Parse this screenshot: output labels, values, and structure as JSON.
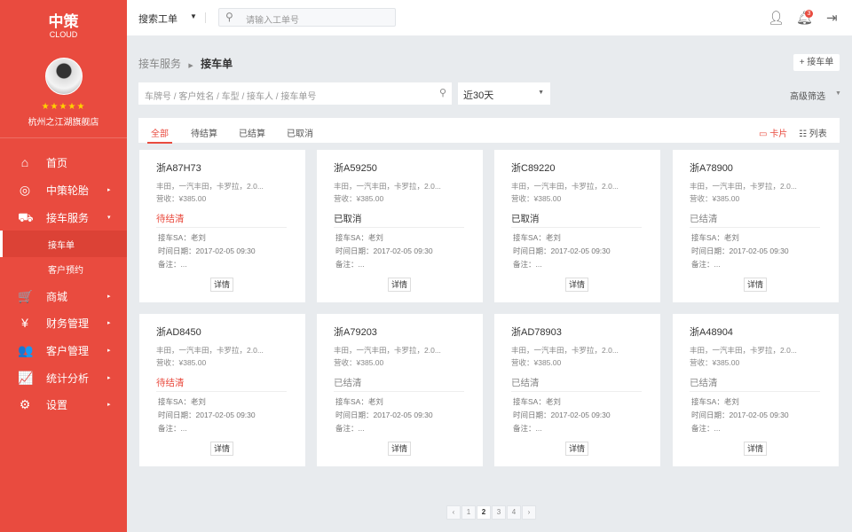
{
  "sidebar": {
    "logo_cn": "中策",
    "logo_en": "CLOUD",
    "stars": "★★★★★",
    "store": "杭州之江湖旗舰店",
    "items": [
      {
        "label": "首页",
        "icon": "⌂",
        "arrow": ""
      },
      {
        "label": "中策轮胎",
        "icon": "◎",
        "arrow": "▸"
      },
      {
        "label": "接车服务",
        "icon": "⛟",
        "arrow": "▾"
      },
      {
        "label": "接车单",
        "icon": "",
        "arrow": ""
      },
      {
        "label": "客户预约",
        "icon": "",
        "arrow": ""
      },
      {
        "label": "商城",
        "icon": "🛒",
        "arrow": "▸"
      },
      {
        "label": "财务管理",
        "icon": "¥",
        "arrow": "▸"
      },
      {
        "label": "客户管理",
        "icon": "👥",
        "arrow": "▸"
      },
      {
        "label": "统计分析",
        "icon": "📈",
        "arrow": "▸"
      },
      {
        "label": "设置",
        "icon": "⚙",
        "arrow": "▸"
      }
    ]
  },
  "topbar": {
    "search_type": "搜索工单",
    "search_placeholder": "请输入工单号",
    "notif_count": "3"
  },
  "breadcrumb": {
    "parent": "接车服务",
    "current": "接车单"
  },
  "add_button": "+ 接车单",
  "filter": {
    "placeholder": "车牌号 / 客户姓名 / 车型 / 接车人 / 接车单号",
    "range": "近30天",
    "advanced": "高级筛选"
  },
  "tabs": [
    "全部",
    "待结算",
    "已结算",
    "已取消"
  ],
  "views": {
    "card": "卡片",
    "list": "列表"
  },
  "colors": {
    "accent": "#e94b3f",
    "unpaid": "#e94b3f",
    "cancelled": "#333333",
    "paid": "#888888"
  },
  "cards": [
    {
      "plate": "浙A87H73",
      "model": "丰田，一汽丰田，卡罗拉，2.0...",
      "revenue": "营收：¥385.00",
      "status": "待结清",
      "status_type": "unpaid",
      "sa": "接车SA：老刘",
      "time": "时间日期：2017-02-05 09:30",
      "note": "备注：...",
      "btn": "详情"
    },
    {
      "plate": "浙A59250",
      "model": "丰田，一汽丰田，卡罗拉，2.0...",
      "revenue": "营收：¥385.00",
      "status": "已取消",
      "status_type": "cancelled",
      "sa": "接车SA：老刘",
      "time": "时间日期：2017-02-05 09:30",
      "note": "备注：...",
      "btn": "详情"
    },
    {
      "plate": "浙C89220",
      "model": "丰田，一汽丰田，卡罗拉，2.0...",
      "revenue": "营收：¥385.00",
      "status": "已取消",
      "status_type": "cancelled",
      "sa": "接车SA：老刘",
      "time": "时间日期：2017-02-05 09:30",
      "note": "备注：...",
      "btn": "详情"
    },
    {
      "plate": "浙A78900",
      "model": "丰田，一汽丰田，卡罗拉，2.0...",
      "revenue": "营收：¥385.00",
      "status": "已结清",
      "status_type": "paid",
      "sa": "接车SA：老刘",
      "time": "时间日期：2017-02-05 09:30",
      "note": "备注：...",
      "btn": "详情"
    },
    {
      "plate": "浙AD8450",
      "model": "丰田，一汽丰田，卡罗拉，2.0...",
      "revenue": "营收：¥385.00",
      "status": "待结清",
      "status_type": "unpaid",
      "sa": "接车SA：老刘",
      "time": "时间日期：2017-02-05 09:30",
      "note": "备注：...",
      "btn": "详情"
    },
    {
      "plate": "浙A79203",
      "model": "丰田，一汽丰田，卡罗拉，2.0...",
      "revenue": "营收：¥385.00",
      "status": "已结清",
      "status_type": "paid",
      "sa": "接车SA：老刘",
      "time": "时间日期：2017-02-05 09:30",
      "note": "备注：...",
      "btn": "详情"
    },
    {
      "plate": "浙AD78903",
      "model": "丰田，一汽丰田，卡罗拉，2.0...",
      "revenue": "营收：¥385.00",
      "status": "已结清",
      "status_type": "paid",
      "sa": "接车SA：老刘",
      "time": "时间日期：2017-02-05 09:30",
      "note": "备注：...",
      "btn": "详情"
    },
    {
      "plate": "浙A48904",
      "model": "丰田，一汽丰田，卡罗拉，2.0...",
      "revenue": "营收：¥385.00",
      "status": "已结清",
      "status_type": "paid",
      "sa": "接车SA：老刘",
      "time": "时间日期：2017-02-05 09:30",
      "note": "备注：...",
      "btn": "详情"
    }
  ],
  "pagination": {
    "prev": "‹",
    "pages": [
      "1",
      "2",
      "3",
      "4"
    ],
    "current": "2",
    "next": "›"
  }
}
